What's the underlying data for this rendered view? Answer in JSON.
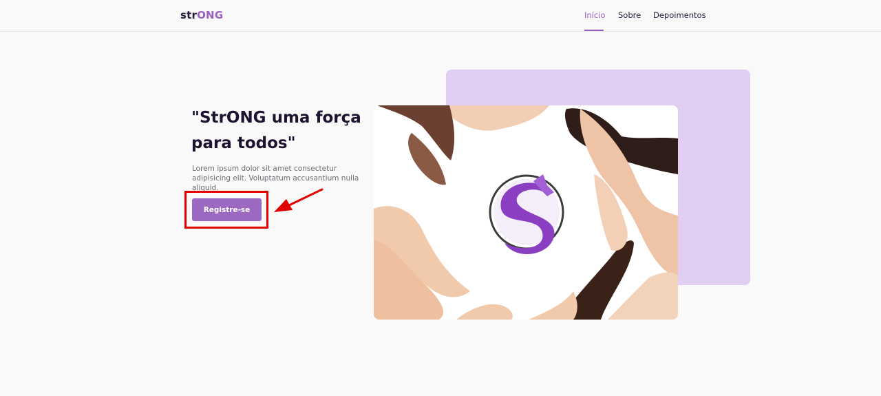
{
  "brand": {
    "part1": "str",
    "part2": "ONG"
  },
  "nav": {
    "items": [
      {
        "label": "Início",
        "active": true
      },
      {
        "label": "Sobre",
        "active": false
      },
      {
        "label": "Depoimentos",
        "active": false
      }
    ]
  },
  "hero": {
    "title": "\"StrONG uma força para todos\"",
    "text": "Lorem ipsum dolor sit amet consectetur adipisicing elit. Voluptatum accusantium nulla aliquid.",
    "cta_label": "Registre-se"
  },
  "colors": {
    "accent": "#9b68c2",
    "brand_purple": "#9b5fc0",
    "shape_lavender": "#e2cdf3",
    "annotation_red": "#e00000"
  }
}
